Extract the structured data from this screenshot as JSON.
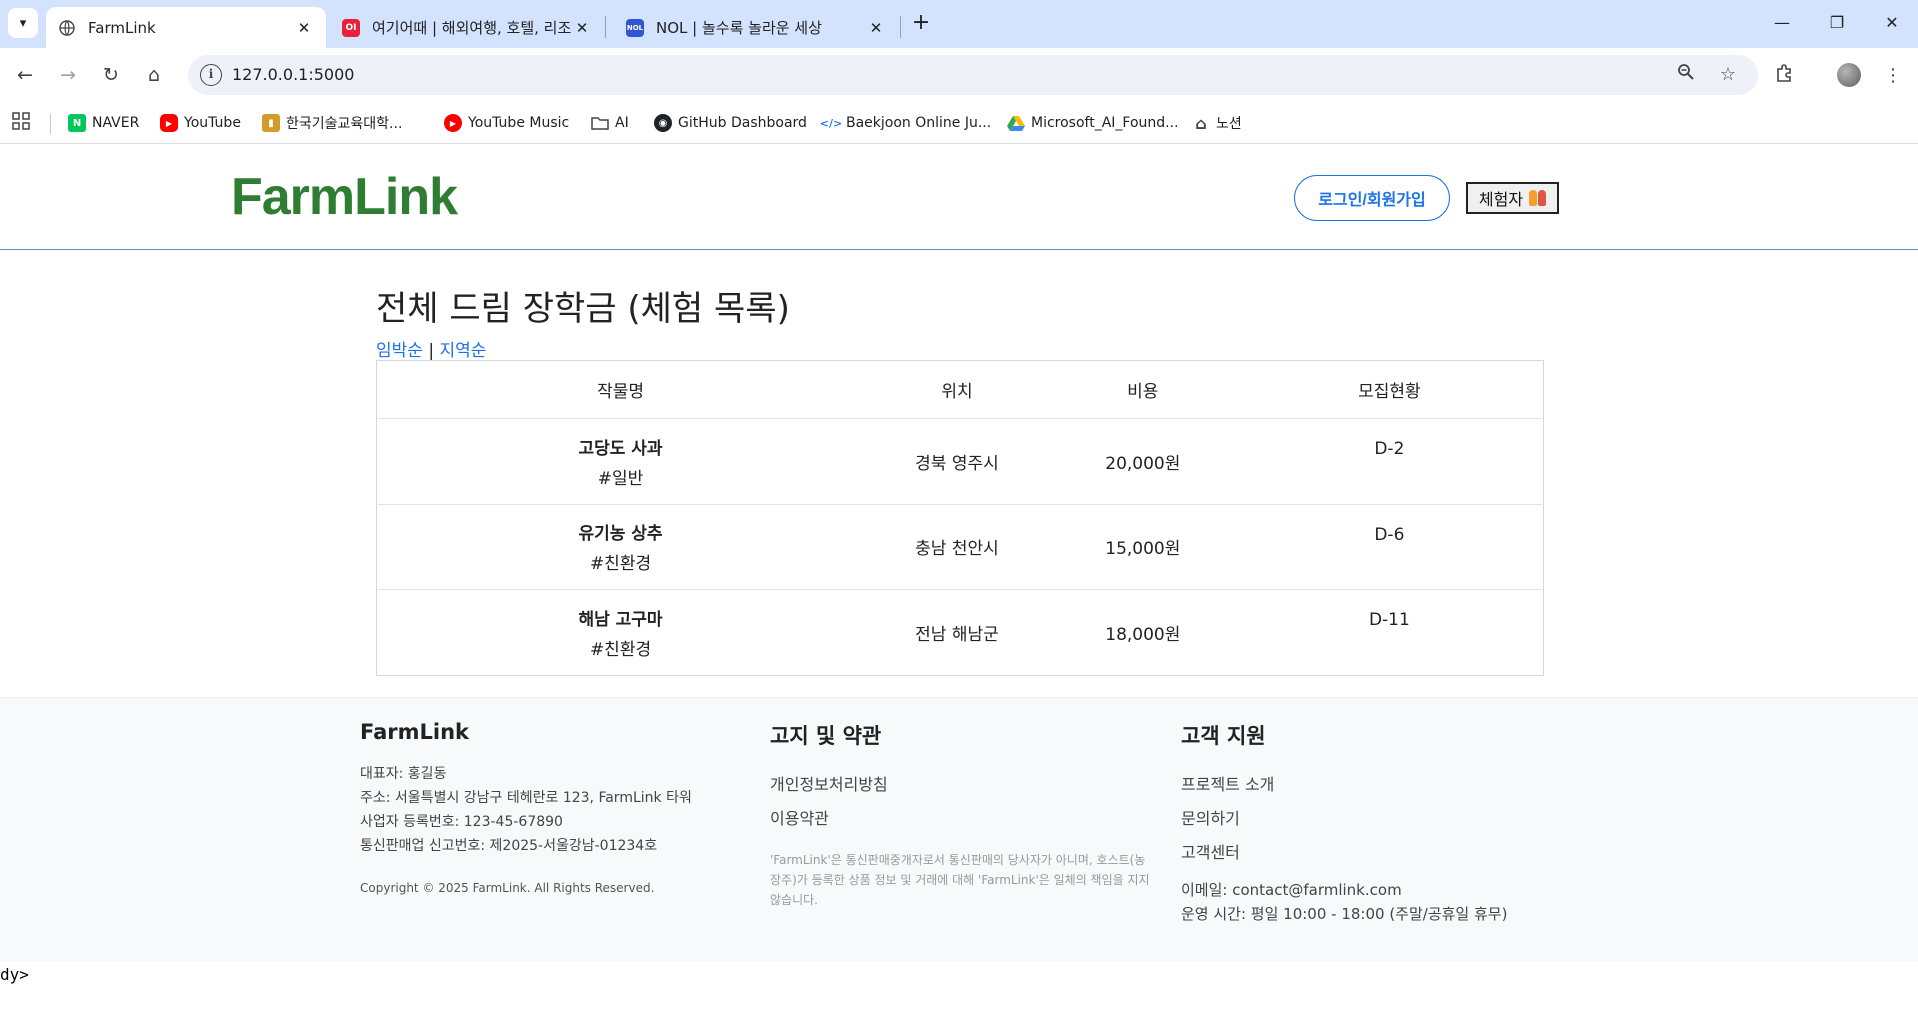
{
  "browser": {
    "tabs": [
      {
        "title": "FarmLink",
        "active": true
      },
      {
        "title": "여기어때 | 해외여행, 호텔, 리조",
        "active": false
      },
      {
        "title": "NOL | 놀수록 놀라운 세상",
        "active": false
      }
    ],
    "url": "127.0.0.1:5000",
    "bookmarks": [
      "NAVER",
      "YouTube",
      "한국기술교육대학...",
      "YouTube Music",
      "AI",
      "GitHub Dashboard",
      "Baekjoon Online Ju...",
      "Microsoft_AI_Found...",
      "노션"
    ]
  },
  "header": {
    "logo": "FarmLink",
    "login_label": "로그인/회원가입",
    "role_label": "체험자"
  },
  "main": {
    "title": "전체 드림 장학금 (체험 목록)",
    "sort_links": [
      "임박순",
      "지역순"
    ],
    "sort_separator": "|",
    "columns": [
      "작물명",
      "위치",
      "비용",
      "모집현황"
    ],
    "rows": [
      {
        "name": "고당도 사과",
        "tag": "#일반",
        "location": "경북 영주시",
        "price": "20,000원",
        "status": "D-2"
      },
      {
        "name": "유기농 상추",
        "tag": "#친환경",
        "location": "충남 천안시",
        "price": "15,000원",
        "status": "D-6"
      },
      {
        "name": "해남 고구마",
        "tag": "#친환경",
        "location": "전남 해남군",
        "price": "18,000원",
        "status": "D-11"
      }
    ]
  },
  "footer": {
    "company": {
      "title": "FarmLink",
      "ceo": "대표자: 홍길동",
      "address": "주소: 서울특별시 강남구 테헤란로 123, FarmLink 타워",
      "business_no": "사업자 등록번호: 123-45-67890",
      "ecommerce_no": "통신판매업 신고번호: 제2025-서울강남-01234호",
      "copyright": "Copyright © 2025 FarmLink. All Rights Reserved."
    },
    "legal": {
      "title": "고지 및 약관",
      "links": [
        "개인정보처리방침",
        "이용약관"
      ],
      "disclaimer": "'FarmLink'은 통신판매중개자로서 통신판매의 당사자가 아니며, 호스트(농장주)가 등록한 상품 정보 및 거래에 대해 'FarmLink'은 일체의 책임을 지지 않습니다."
    },
    "support": {
      "title": "고객 지원",
      "links": [
        "프로젝트 소개",
        "문의하기",
        "고객센터"
      ],
      "email": "이메일: contact@farmlink.com",
      "hours": "운영 시간: 평일 10:00 - 18:00 (주말/공휴일 휴무)"
    }
  },
  "stray_text": "dy>",
  "colors": {
    "brand_green": "#2e7d32",
    "link_blue": "#1a73e8",
    "tabstrip": "#d3e3fd"
  }
}
